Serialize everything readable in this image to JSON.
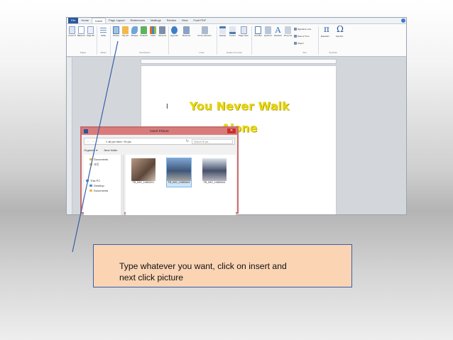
{
  "word": {
    "tabs": [
      "File",
      "Home",
      "Insert",
      "Page Layout",
      "References",
      "Mailings",
      "Review",
      "View",
      "Foxit PDF"
    ],
    "active_tab": "Insert",
    "ribbon_buttons": [
      {
        "label": "Cover Page",
        "icon": "cover-page-icon"
      },
      {
        "label": "Blank Page",
        "icon": "blank-page-icon"
      },
      {
        "label": "Page Break",
        "icon": "page-break-icon"
      },
      {
        "label": "Table",
        "icon": "table-icon"
      },
      {
        "label": "Picture",
        "icon": "picture-icon"
      },
      {
        "label": "Clip Art",
        "icon": "clip-art-icon"
      },
      {
        "label": "Shapes",
        "icon": "shapes-icon"
      },
      {
        "label": "SmartArt",
        "icon": "smartart-icon"
      },
      {
        "label": "Chart",
        "icon": "chart-icon"
      },
      {
        "label": "Screenshot",
        "icon": "screenshot-icon"
      },
      {
        "label": "Hyperlink",
        "icon": "hyperlink-icon"
      },
      {
        "label": "Bookmark",
        "icon": "bookmark-icon"
      },
      {
        "label": "Cross-reference",
        "icon": "cross-reference-icon"
      },
      {
        "label": "Header",
        "icon": "header-icon"
      },
      {
        "label": "Footer",
        "icon": "footer-icon"
      },
      {
        "label": "Page Number",
        "icon": "page-number-icon"
      },
      {
        "label": "Text Box",
        "icon": "text-box-icon"
      },
      {
        "label": "Quick Parts",
        "icon": "quick-parts-icon"
      },
      {
        "label": "WordArt",
        "icon": "wordart-icon"
      },
      {
        "label": "Drop Cap",
        "icon": "drop-cap-icon"
      }
    ],
    "small_commands": [
      "Signature Line",
      "Date & Time",
      "Object"
    ],
    "symbol_buttons": [
      {
        "glyph": "π",
        "label": "Equation"
      },
      {
        "glyph": "Ω",
        "label": "Symbol"
      }
    ],
    "groups": [
      "Pages",
      "Tables",
      "Illustrations",
      "Links",
      "Header & Footer",
      "Text",
      "Symbols"
    ],
    "document": {
      "cursor": "I",
      "title_line1": "You Never Walk",
      "title_line2": "Alone",
      "title_color": "#e9d700"
    }
  },
  "dialog": {
    "title": "Insert Picture",
    "close": "✕",
    "breadcrumb": "« all pic here › fb pic",
    "search_placeholder": "Search fb pic",
    "toolbar": [
      "Organize ▾",
      "New folder"
    ],
    "nav_items": [
      {
        "label": "Documents",
        "icon": "folder-icon"
      },
      {
        "label": "사진",
        "icon": "folder-icon"
      },
      {
        "label": "This PC",
        "icon": "pc-icon"
      },
      {
        "label": "Desktop",
        "icon": "folder-icon"
      },
      {
        "label": "Documents",
        "icon": "folder-icon"
      }
    ],
    "files": [
      {
        "name": "FB_IMG_14863201",
        "selected": false
      },
      {
        "name": "FB_IMG_14865464",
        "selected": true
      },
      {
        "name": "FB_IMG_14865464",
        "selected": false
      }
    ],
    "border_color": "#c76c6c"
  },
  "callout": {
    "text_line1": "Type whatever you want, click on insert and",
    "text_line2": "next click picture",
    "bg_color": "#fbd4b4",
    "border_color": "#3a5ea8"
  }
}
